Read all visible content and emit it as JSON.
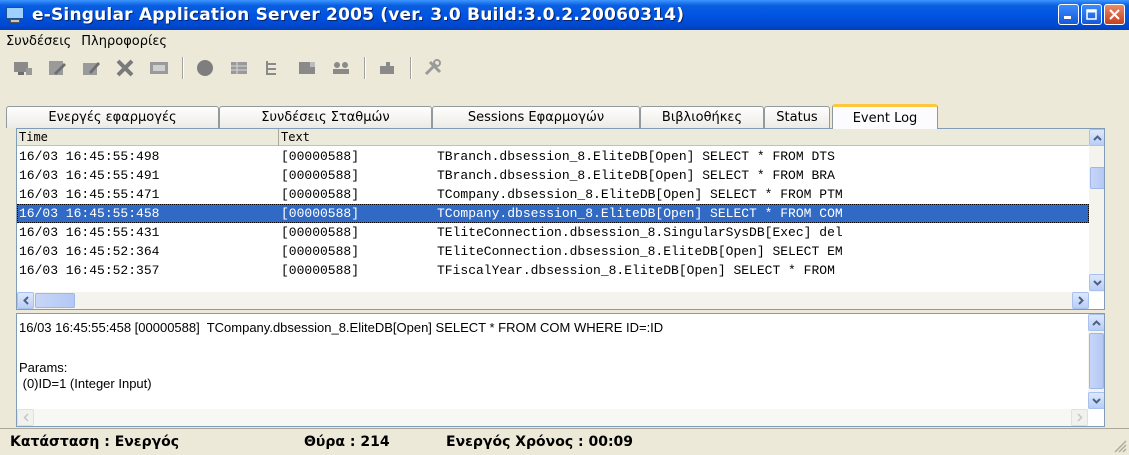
{
  "window": {
    "title": "e-Singular Application Server 2005 (ver. 3.0 Build:3.0.2.20060314)"
  },
  "menu": [
    "Συνδέσεις",
    "Πληροφορίες"
  ],
  "toolbar": {
    "icons": [
      "disconnect-icon",
      "edit-icon",
      "edit-alt-icon",
      "delete-icon",
      "message-icon",
      "record-icon",
      "table-icon",
      "tree-icon",
      "card-icon",
      "users-icon",
      "plugin-icon",
      "tools-icon"
    ]
  },
  "tabs": [
    {
      "label": "Ενεργές εφαρμογές"
    },
    {
      "label": "Συνδέσεις Σταθμών"
    },
    {
      "label": "Sessions Εφαρμογών"
    },
    {
      "label": "Βιβλιοθήκες"
    },
    {
      "label": "Status"
    },
    {
      "label": "Event Log"
    }
  ],
  "active_tab": "Event Log",
  "log": {
    "columns": [
      "Time",
      "Text"
    ],
    "rows": [
      {
        "time": "16/03 16:45:55:498",
        "thread": "[00000588]",
        "text": "TBranch.dbsession_8.EliteDB[Open] SELECT * FROM DTS"
      },
      {
        "time": "16/03 16:45:55:491",
        "thread": "[00000588]",
        "text": "TBranch.dbsession_8.EliteDB[Open] SELECT * FROM BRA"
      },
      {
        "time": "16/03 16:45:55:471",
        "thread": "[00000588]",
        "text": "TCompany.dbsession_8.EliteDB[Open] SELECT * FROM PTM"
      },
      {
        "time": "16/03 16:45:55:458",
        "thread": "[00000588]",
        "text": "TCompany.dbsession_8.EliteDB[Open] SELECT * FROM COM"
      },
      {
        "time": "16/03 16:45:55:431",
        "thread": "[00000588]",
        "text": "TEliteConnection.dbsession_8.SingularSysDB[Exec] del"
      },
      {
        "time": "16/03 16:45:52:364",
        "thread": "[00000588]",
        "text": "TEliteConnection.dbsession_8.EliteDB[Open] SELECT EM"
      },
      {
        "time": "16/03 16:45:52:357",
        "thread": "[00000588]",
        "text": "TFiscalYear.dbsession_8.EliteDB[Open] SELECT * FROM"
      }
    ],
    "selected_index": 3
  },
  "detail": {
    "lines": [
      "16/03 16:45:55:458 [00000588]  TCompany.dbsession_8.EliteDB[Open] SELECT * FROM COM WHERE ID=:ID",
      "",
      "Params:",
      " (0)ID=1 (Integer Input)"
    ]
  },
  "status": {
    "state": "Κατάσταση : Ενεργός",
    "port": "Θύρα : 214",
    "uptime": "Ενεργός Χρόνος : 00:09"
  },
  "colors": {
    "titlebar": "#0054e3",
    "selection": "#316ac5",
    "window_bg": "#ece9d8",
    "active_tab_accent": "#ffc83c"
  }
}
